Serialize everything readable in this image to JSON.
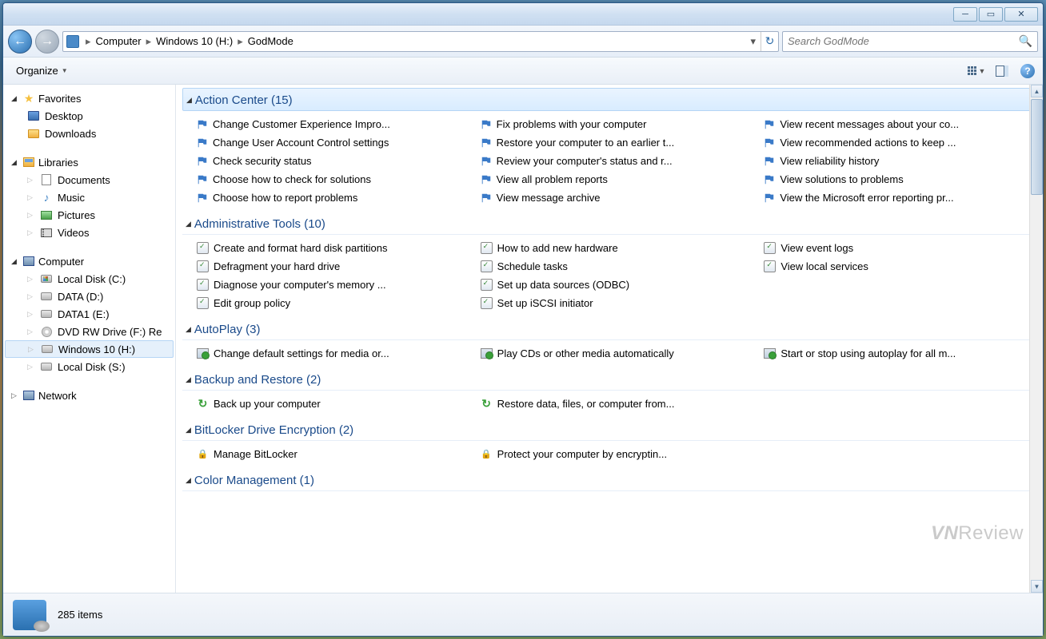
{
  "titlebar": {
    "minimize": "─",
    "maximize": "▭",
    "close": "✕"
  },
  "address": {
    "crumbs": [
      "Computer",
      "Windows 10 (H:)",
      "GodMode"
    ],
    "search_placeholder": "Search GodMode"
  },
  "toolbar": {
    "organize": "Organize"
  },
  "sidebar": {
    "favorites": {
      "label": "Favorites",
      "items": [
        "Desktop",
        "Downloads"
      ]
    },
    "libraries": {
      "label": "Libraries",
      "items": [
        "Documents",
        "Music",
        "Pictures",
        "Videos"
      ]
    },
    "computer": {
      "label": "Computer",
      "items": [
        "Local Disk (C:)",
        "DATA (D:)",
        "DATA1 (E:)",
        "DVD RW Drive (F:) Re",
        "Windows 10 (H:)",
        "Local Disk (S:)"
      ]
    },
    "network": {
      "label": "Network"
    }
  },
  "groups": [
    {
      "title": "Action Center",
      "count": 15,
      "selected": true,
      "iconType": "flag",
      "items": [
        "Change Customer Experience Impro...",
        "Change User Account Control settings",
        "Check security status",
        "Choose how to check for solutions",
        "Choose how to report problems",
        "Fix problems with your computer",
        "Restore your computer to an earlier t...",
        "Review your computer's status and r...",
        "View all problem reports",
        "View message archive",
        "View recent messages about your co...",
        "View recommended actions to keep ...",
        "View reliability history",
        "View solutions to problems",
        "View the Microsoft error reporting pr..."
      ]
    },
    {
      "title": "Administrative Tools",
      "count": 10,
      "iconType": "gearcheck",
      "items": [
        "Create and format hard disk partitions",
        "Defragment your hard drive",
        "Diagnose your computer's memory ...",
        "Edit group policy",
        "How to add new hardware",
        "Schedule tasks",
        "Set up data sources (ODBC)",
        "Set up iSCSI initiator",
        "View event logs",
        "View local services"
      ]
    },
    {
      "title": "AutoPlay",
      "count": 3,
      "iconType": "play",
      "items": [
        "Change default settings for media or...",
        "Play CDs or other media automatically",
        "Start or stop using autoplay for all m..."
      ]
    },
    {
      "title": "Backup and Restore",
      "count": 2,
      "iconType": "backup",
      "items": [
        "Back up your computer",
        "Restore data, files, or computer from..."
      ]
    },
    {
      "title": "BitLocker Drive Encryption",
      "count": 2,
      "iconType": "lock",
      "items": [
        "Manage BitLocker",
        "Protect your computer by encryptin..."
      ]
    },
    {
      "title": "Color Management",
      "count": 1,
      "iconType": "play",
      "items": []
    }
  ],
  "status": {
    "count_label": "285 items"
  },
  "watermark": "VNReview"
}
